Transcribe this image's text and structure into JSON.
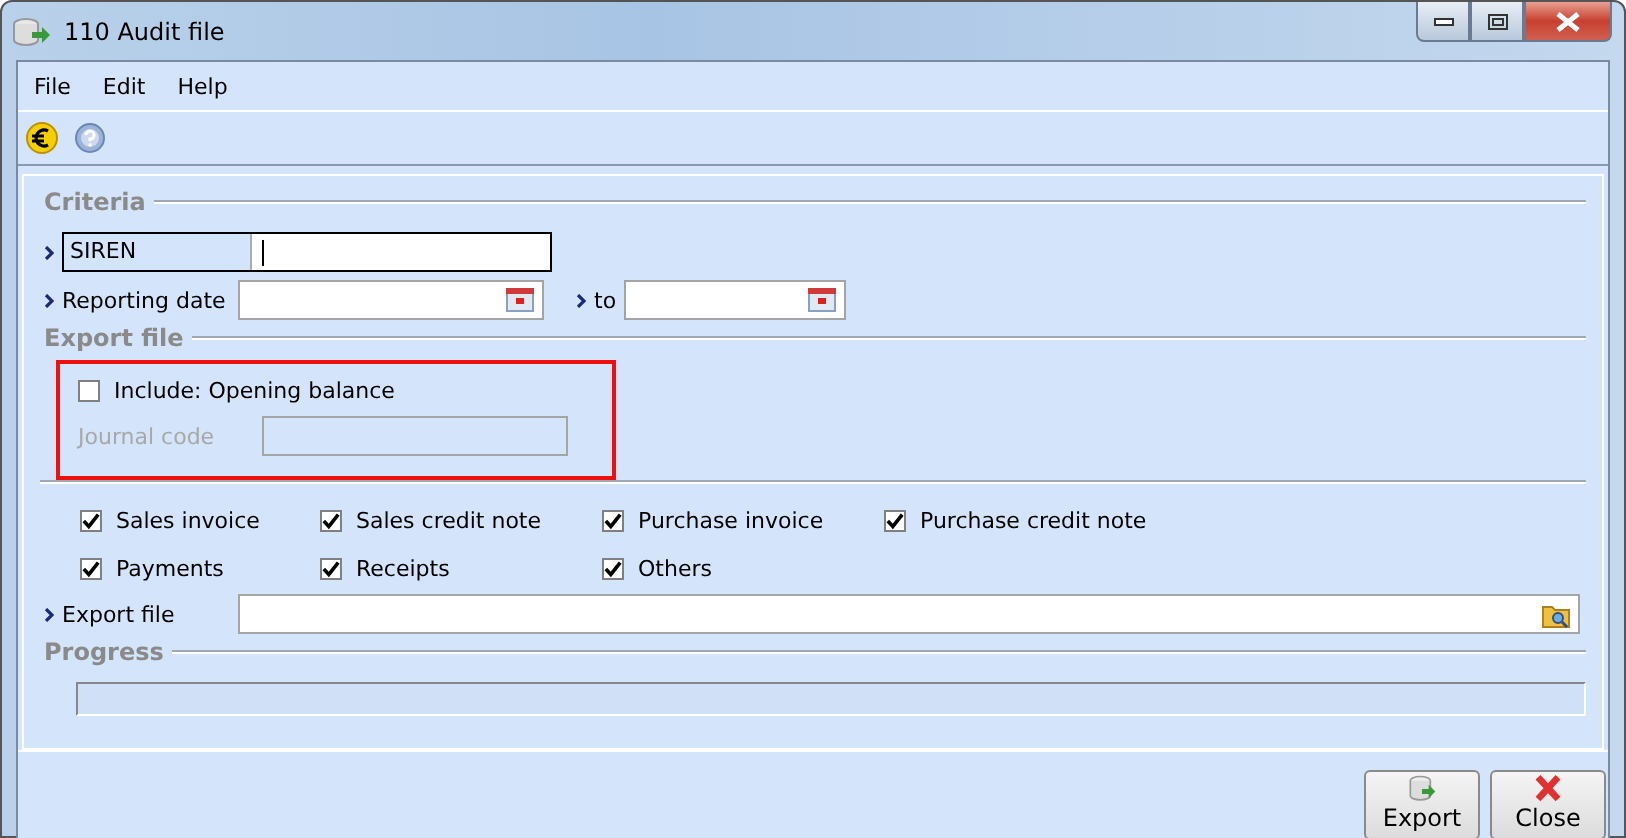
{
  "window": {
    "title": "110 Audit file"
  },
  "menu": [
    "File",
    "Edit",
    "Help"
  ],
  "criteria": {
    "heading": "Criteria",
    "siren_label": "SIREN",
    "date_label": "Reporting date",
    "to_label": "to"
  },
  "export": {
    "heading": "Export file",
    "include": {
      "label": "Include: Opening balance",
      "checked": false
    },
    "journal": {
      "label": "Journal code",
      "disabled": true
    },
    "types": [
      {
        "label": "Sales invoice",
        "checked": true
      },
      {
        "label": "Sales credit note",
        "checked": true
      },
      {
        "label": "Purchase invoice",
        "checked": true
      },
      {
        "label": "Purchase credit note",
        "checked": true
      },
      {
        "label": "Payments",
        "checked": true
      },
      {
        "label": "Receipts",
        "checked": true
      },
      {
        "label": "Others",
        "checked": true
      }
    ],
    "file_label": "Export file"
  },
  "progress": {
    "heading": "Progress",
    "level": 0
  },
  "buttons": [
    {
      "label": "Export",
      "kind": "export"
    },
    {
      "label": "Close",
      "kind": "close"
    }
  ]
}
